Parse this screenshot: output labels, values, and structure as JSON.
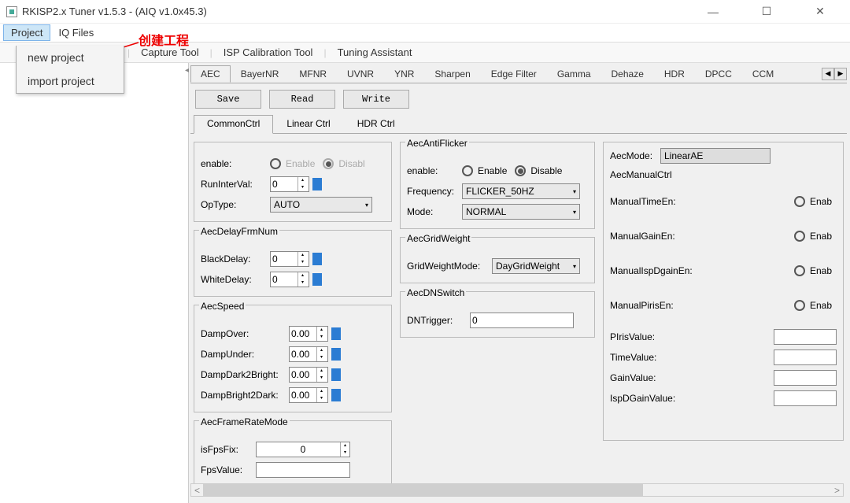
{
  "window": {
    "title": "RKISP2.x Tuner v1.5.3 - (AIQ v1.0x45.3)"
  },
  "menubar": {
    "project": "Project",
    "iqfiles": "IQ Files"
  },
  "annotation": "创建工程",
  "dropdown": {
    "new": "new project",
    "import": "import project"
  },
  "toolbar": {
    "capture": "Capture Tool",
    "cal": "ISP Calibration Tool",
    "tuning": "Tuning Assistant"
  },
  "tabs": [
    "AEC",
    "BayerNR",
    "MFNR",
    "UVNR",
    "YNR",
    "Sharpen",
    "Edge Filter",
    "Gamma",
    "Dehaze",
    "HDR",
    "DPCC",
    "CCM"
  ],
  "buttons": {
    "save": "Save",
    "read": "Read",
    "write": "Write"
  },
  "subtabs": {
    "common": "CommonCtrl",
    "linear": "Linear Ctrl",
    "hdr": "HDR Ctrl"
  },
  "g1": {
    "enable_lbl": "enable:",
    "enable_opt": "Enable",
    "disable_opt": "Disabl",
    "runint_lbl": "RunInterVal:",
    "runint_val": "0",
    "optype_lbl": "OpType:",
    "optype_val": "AUTO"
  },
  "g2": {
    "title": "AecDelayFrmNum",
    "black_lbl": "BlackDelay:",
    "black_val": "0",
    "white_lbl": "WhiteDelay:",
    "white_val": "0"
  },
  "g3": {
    "title": "AecSpeed",
    "over_lbl": "DampOver:",
    "over_val": "0.00",
    "under_lbl": "DampUnder:",
    "under_val": "0.00",
    "d2b_lbl": "DampDark2Bright:",
    "d2b_val": "0.00",
    "b2d_lbl": "DampBright2Dark:",
    "b2d_val": "0.00"
  },
  "g4": {
    "title": "AecFrameRateMode",
    "fix_lbl": "isFpsFix:",
    "fix_val": "0",
    "val_lbl": "FpsValue:"
  },
  "g5": {
    "title": "AecAntiFlicker",
    "enable_lbl": "enable:",
    "enable_opt": "Enable",
    "disable_opt": "Disable",
    "freq_lbl": "Frequency:",
    "freq_val": "FLICKER_50HZ",
    "mode_lbl": "Mode:",
    "mode_val": "NORMAL"
  },
  "g6": {
    "title": "AecGridWeight",
    "mode_lbl": "GridWeightMode:",
    "mode_val": "DayGridWeight"
  },
  "g7": {
    "title": "AecDNSwitch",
    "trig_lbl": "DNTrigger:",
    "trig_val": "0"
  },
  "g8": {
    "mode_lbl": "AecMode:",
    "mode_val": "LinearAE",
    "manual_title": "AecManualCtrl",
    "timeen": "ManualTimeEn:",
    "gainen": "ManualGainEn:",
    "ispdgainen": "ManualIspDgainEn:",
    "pirisen": "ManualPirisEn:",
    "enable_opt": "Enab",
    "piris_lbl": "PIrisValue:",
    "time_lbl": "TimeValue:",
    "gain_lbl": "GainValue:",
    "ispd_lbl": "IspDGainValue:"
  }
}
